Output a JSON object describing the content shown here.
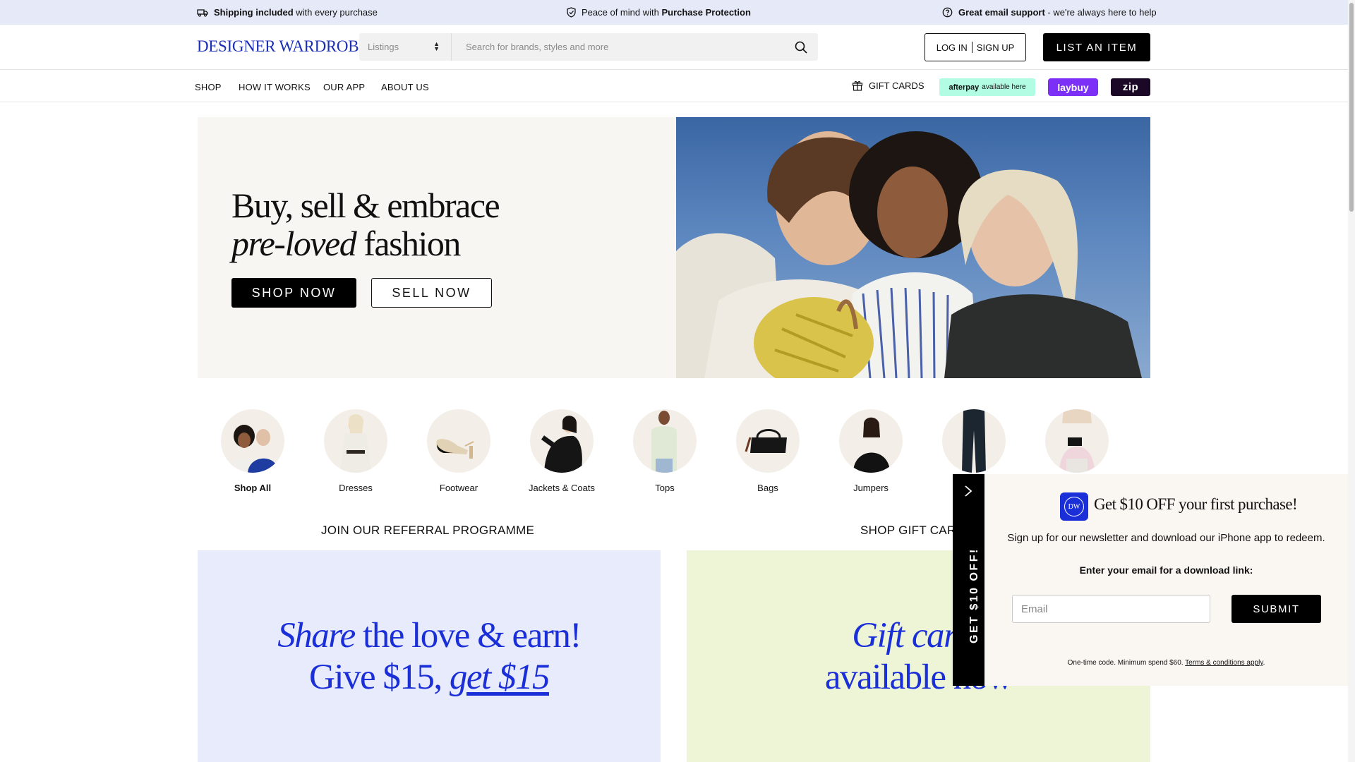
{
  "announcement": {
    "shipping_bold": "Shipping included",
    "shipping_rest": " with every purchase",
    "protection_pre": "Peace of mind with ",
    "protection_bold": "Purchase Protection",
    "support_bold": "Great email support",
    "support_rest": " - we're always here to help"
  },
  "header": {
    "logo": "DESIGNER WARDROBE",
    "search_category": "Listings",
    "search_placeholder": "Search for brands, styles and more",
    "login_label": "LOG IN",
    "signup_label": "SIGN UP",
    "list_item_label": "LIST AN ITEM"
  },
  "nav": {
    "items": [
      "SHOP",
      "HOW IT WORKS",
      "OUR APP",
      "ABOUT US"
    ],
    "gift_cards": "GIFT CARDS",
    "afterpay_brand": "afterpay",
    "afterpay_text": "available here",
    "laybuy": "laybuy",
    "zip": "zip"
  },
  "hero": {
    "line1": "Buy, sell & embrace",
    "line2_italic": "pre-loved",
    "line2_rest": " fashion",
    "shop_now": "SHOP NOW",
    "sell_now": "SELL NOW"
  },
  "categories": [
    "Shop All",
    "Dresses",
    "Footwear",
    "Jackets & Coats",
    "Tops",
    "Bags",
    "Jumpers",
    "",
    ""
  ],
  "referral": {
    "title": "JOIN OUR REFERRAL PROGRAMME",
    "share_italic": "Share",
    "share_rest": " the love & earn!",
    "give": "Give $15, ",
    "get": "get $15"
  },
  "giftcards": {
    "title": "SHOP GIFT CARDS",
    "line1": "Gift cards",
    "line2": "available now"
  },
  "popup": {
    "tab_label": "GET $10 OFF!",
    "badge": "DW",
    "headline": "Get $10 OFF your first purchase!",
    "subtitle": "Sign up for our newsletter and download our iPhone app to redeem.",
    "email_label": "Enter your email for a download link:",
    "email_placeholder": "Email",
    "submit": "SUBMIT",
    "fine_print": "One-time code. Minimum spend $60. ",
    "terms": "Terms & conditions apply",
    "fine_end": "."
  },
  "colors": {
    "announce_bg": "#e6eaf8",
    "brand_blue": "#1b2fd9",
    "referral_bg": "#e8ebfb",
    "giftcard_bg": "#eef5d7",
    "popup_bg": "#faf7f2"
  }
}
